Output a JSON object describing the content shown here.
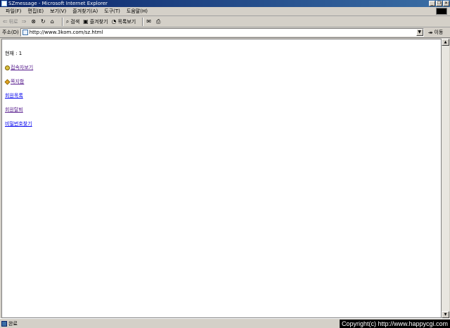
{
  "window": {
    "title": "SZmessage - Microsoft Internet Explorer",
    "controls": [
      "_",
      "❐",
      "✕"
    ]
  },
  "menu": [
    "파일(F)",
    "편집(E)",
    "보기(V)",
    "즐겨찾기(A)",
    "도구(T)",
    "도움말(H)"
  ],
  "toolbar": {
    "back": "뒤로",
    "forward": "앞으로",
    "search": "검색",
    "favorites": "즐겨찾기",
    "history": "목록보기"
  },
  "address": {
    "label": "주소(D)",
    "url": "http://www.3kom.com/sz.html",
    "go": "이동"
  },
  "content": {
    "current": "현재 : 1",
    "links": [
      "접속자보기",
      "쪽지함",
      "회원목록",
      "회원탈퇴",
      "비밀번호찾기"
    ]
  },
  "status": {
    "text": "완료",
    "copyright": "Copyright(c) http://www.happycgi.com"
  }
}
